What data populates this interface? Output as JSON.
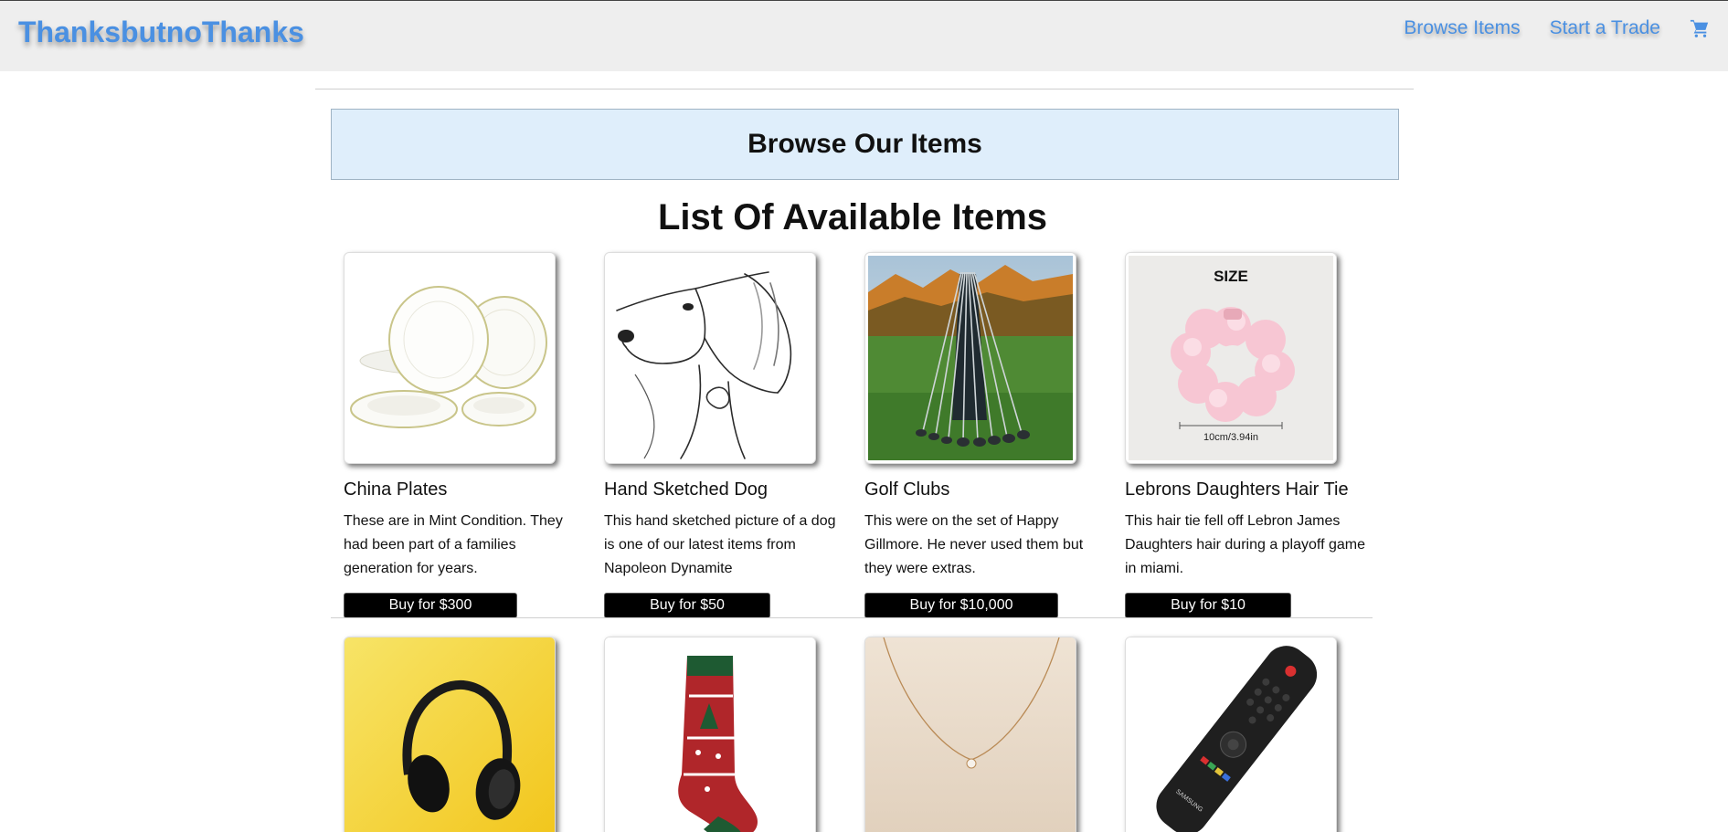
{
  "nav": {
    "brand": "ThanksbutnoThanks",
    "links": [
      "Browse Items",
      "Start a Trade"
    ],
    "cart_icon": "cart-icon",
    "accent_color": "#4a90e2"
  },
  "banner": {
    "title": "Browse Our Items",
    "background": "#dfeefb"
  },
  "section": {
    "title": "List Of Available Items"
  },
  "items": [
    {
      "name": "China Plates",
      "description": "These are in Mint Condition. They had been part of a families generation for years.",
      "button": "Buy for $300"
    },
    {
      "name": "Hand Sketched Dog",
      "description": "This hand sketched picture of a dog is one of our latest items from Napoleon Dynamite",
      "button": "Buy for $50"
    },
    {
      "name": "Golf Clubs",
      "description": "This were on the set of Happy Gillmore. He never used them but they were extras.",
      "button": "Buy for $10,000"
    },
    {
      "name": "Lebrons Daughters Hair Tie",
      "description": "This hair tie fell off Lebron James Daughters hair during a playoff game in miami.",
      "button": "Buy for $10",
      "image_text": {
        "top": "SIZE",
        "measure": "10cm/3.94in"
      }
    }
  ],
  "items_row2": [
    {
      "image": "headphones"
    },
    {
      "image": "christmas-sock"
    },
    {
      "image": "necklace"
    },
    {
      "image": "tv-remote",
      "image_text": "SAMSUNG"
    }
  ]
}
